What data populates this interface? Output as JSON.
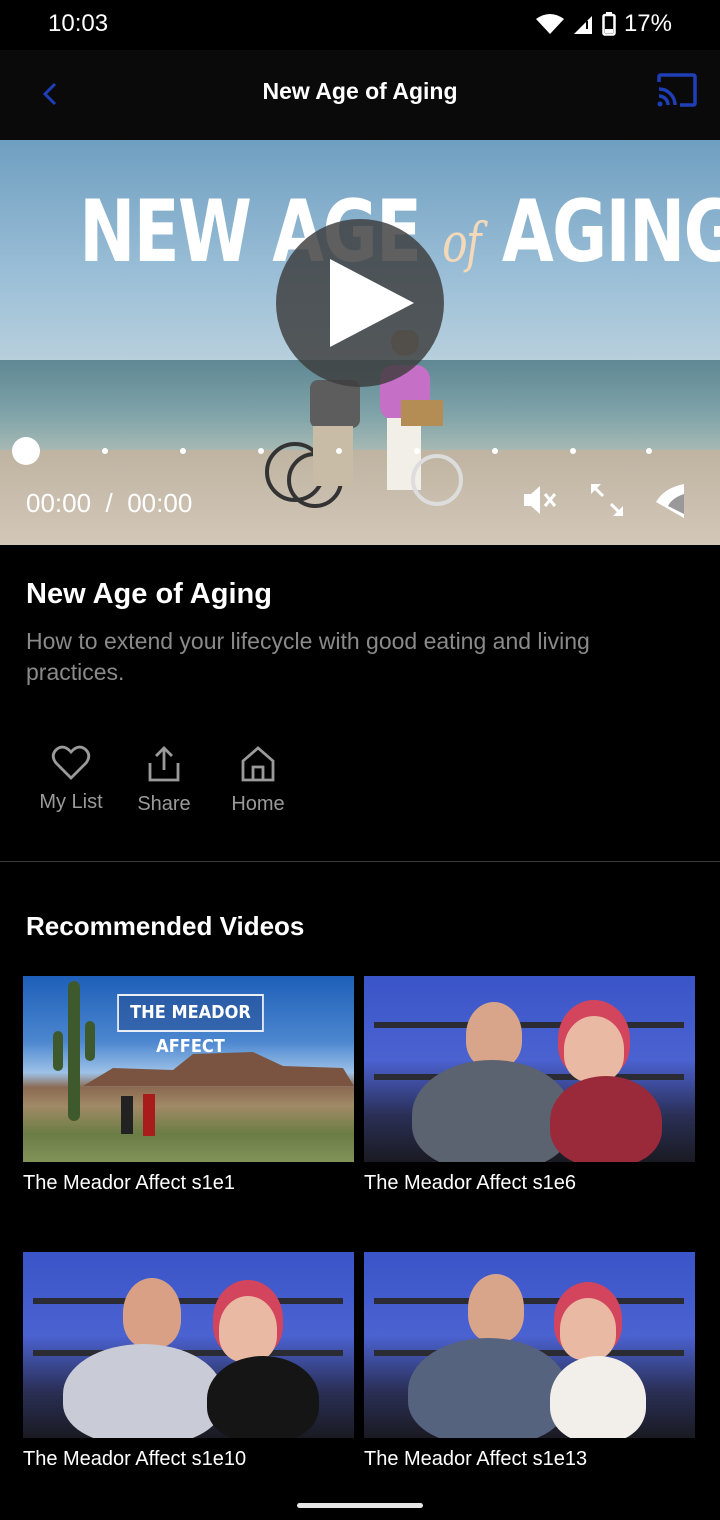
{
  "status_bar": {
    "time": "10:03",
    "battery": "17%"
  },
  "app_bar": {
    "title": "New Age of Aging",
    "back_icon": "chevron-left-icon",
    "cast_icon": "cast-icon",
    "accent": "#1f3fb8"
  },
  "player": {
    "poster_title_left": "NEW AGE",
    "poster_title_mid": "of",
    "poster_title_right": "AGING",
    "time_current": "00:00",
    "time_separator": "/",
    "time_total": "00:00",
    "progress": 0,
    "controls": [
      "mute-icon",
      "fullscreen-icon",
      "cast-signal-icon"
    ]
  },
  "video": {
    "title": "New Age of Aging",
    "description": "How to extend your lifecycle with good eating and living practices."
  },
  "actions": [
    {
      "label": "My List",
      "icon": "heart-icon"
    },
    {
      "label": "Share",
      "icon": "share-icon"
    },
    {
      "label": "Home",
      "icon": "home-icon"
    }
  ],
  "recommended": {
    "title": "Recommended Videos",
    "items": [
      {
        "label": "The Meador Affect s1e1",
        "thumb_text": "THE MEADOR AFFECT"
      },
      {
        "label": "The Meador Affect s1e6"
      },
      {
        "label": "The Meador Affect s1e10"
      },
      {
        "label": "The Meador Affect s1e13"
      }
    ]
  }
}
